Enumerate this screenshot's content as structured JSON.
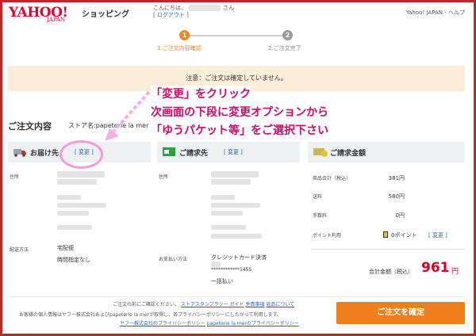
{
  "header": {
    "logo": "YAHOO!",
    "logo_sub": "JAPAN",
    "shopping": "ショッピング",
    "greeting_prefix": "こんにちは、",
    "greeting_suffix": "さん",
    "logout": "[ ログアウト ]",
    "help": "Yahoo! JAPAN - ヘルプ"
  },
  "steps": [
    {
      "number": "1",
      "label": "1.ご注文内容確認"
    },
    {
      "number": "2",
      "label": "2.ご注文完了"
    }
  ],
  "notice": "注意：ご注文は確定していません。",
  "annotation": {
    "line1": "「変更」をクリック",
    "line2": "次画面の下段に変更オプションから",
    "line3": "「ゆうパケット等」をご選択下さい"
  },
  "order": {
    "title": "ご注文内容",
    "store": "ストア名:papeterie la mer"
  },
  "shipping": {
    "title": "お届け先",
    "change": "[ 変更 ]",
    "address_label": "住所",
    "method_label": "配送方法",
    "method_value": "宅配便",
    "time_value": "時間指定なし"
  },
  "billing": {
    "title": "ご請求先",
    "change": "[ 変更 ]",
    "address_label": "住所",
    "payment_label": "お支払い方法",
    "payment_value": "クレジットカード決済",
    "card_mask": "************1455",
    "installment": "一括払い"
  },
  "totals": {
    "title": "ご請求金額",
    "items": [
      {
        "label": "商品合計（税込）",
        "value": "381円"
      },
      {
        "label": "送料",
        "value": "580円"
      },
      {
        "label": "手数料",
        "value": "0円"
      }
    ],
    "points_label": "ポイント利用",
    "points_value": "0ポイント",
    "points_change": "[ 変更 ]",
    "grand_label": "合計金額（税込）",
    "grand_value": "961",
    "grand_unit": "円"
  },
  "footer": {
    "line1_prefix": "ご注文の前にご確認ください。",
    "link_guide": "ストアスタンプラリー ガイド",
    "link_disclaimer": "免責事項",
    "link_about": "返品について",
    "line2": "お客様の個人情報はヤフー株式会社およびpapeterie la merが取得し、各プライバシーポリシーにしたがって利用します。",
    "link_privacy_yahoo": "ヤフー株式会社のプライバシーポリシー",
    "link_privacy_store": "papeterie la merのプライバシーポリシー",
    "confirm": "ご注文を確定"
  },
  "colors": {
    "accent": "#ef7f1a",
    "annotation": "#cc0a6a",
    "frame": "#b22a2a",
    "notice_bg": "#fbeed8"
  }
}
